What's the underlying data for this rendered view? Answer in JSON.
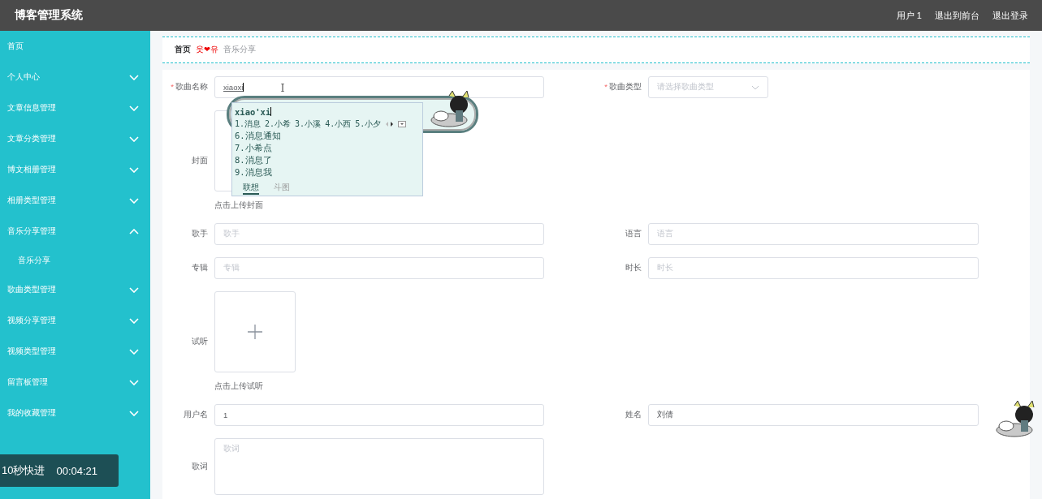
{
  "header": {
    "title": "博客管理系统",
    "links": [
      "用户 1",
      "退出到前台",
      "退出登录"
    ]
  },
  "sidebar": {
    "items": [
      {
        "label": "首页"
      },
      {
        "label": "个人中心",
        "expanded": false
      },
      {
        "label": "文章信息管理",
        "expanded": false
      },
      {
        "label": "文章分类管理",
        "expanded": false
      },
      {
        "label": "博文相册管理",
        "expanded": false
      },
      {
        "label": "相册类型管理",
        "expanded": false
      },
      {
        "label": "音乐分享管理",
        "expanded": true,
        "children": [
          {
            "label": "音乐分享"
          }
        ]
      },
      {
        "label": "歌曲类型管理",
        "expanded": false
      },
      {
        "label": "视频分享管理",
        "expanded": false
      },
      {
        "label": "视频类型管理",
        "expanded": false
      },
      {
        "label": "留言板管理",
        "expanded": false
      },
      {
        "label": "我的收藏管理",
        "expanded": false
      }
    ]
  },
  "breadcrumb": {
    "items": [
      "首页",
      "音乐分享"
    ],
    "separator": "웃❤유"
  },
  "form": {
    "rows": [
      {
        "fields": [
          {
            "kind": "input",
            "label": "歌曲名称",
            "required_mark": "*",
            "value": "xiaoxi",
            "composing": true
          },
          {
            "kind": "select",
            "label": "歌曲类型",
            "required_mark": "*",
            "placeholder": "请选择歌曲类型"
          }
        ]
      },
      {
        "fields": [
          {
            "kind": "upload",
            "label": "封面",
            "hint": "点击上传封面"
          }
        ]
      },
      {
        "fields": [
          {
            "kind": "input",
            "label": "歌手",
            "placeholder": "歌手"
          },
          {
            "kind": "input",
            "label": "语言",
            "placeholder": "语言"
          }
        ]
      },
      {
        "fields": [
          {
            "kind": "input",
            "label": "专辑",
            "placeholder": "专辑"
          },
          {
            "kind": "input",
            "label": "时长",
            "placeholder": "时长"
          }
        ]
      },
      {
        "fields": [
          {
            "kind": "upload",
            "label": "试听",
            "hint": "点击上传试听",
            "show_plus": true
          }
        ]
      },
      {
        "fields": [
          {
            "kind": "input",
            "label": "用户名",
            "value": "1"
          },
          {
            "kind": "input",
            "label": "姓名",
            "value": "刘倩"
          }
        ]
      },
      {
        "fields": [
          {
            "kind": "textarea",
            "label": "歌词",
            "placeholder": "歌词"
          }
        ]
      }
    ]
  },
  "ime_popup": {
    "composition": "xiao'xi",
    "first_line": [
      "1.消息",
      "2.小希",
      "3.小溪",
      "4.小西",
      "5.小夕"
    ],
    "more": [
      "6.消息通知",
      "7.小希点",
      "8.消息了",
      "9.消息我"
    ],
    "tabs": [
      {
        "label": "联想",
        "selected": true
      },
      {
        "label": "斗图",
        "selected": false
      }
    ]
  },
  "overlay_timer": {
    "label": "10秒快进",
    "time": "00:04:21"
  }
}
